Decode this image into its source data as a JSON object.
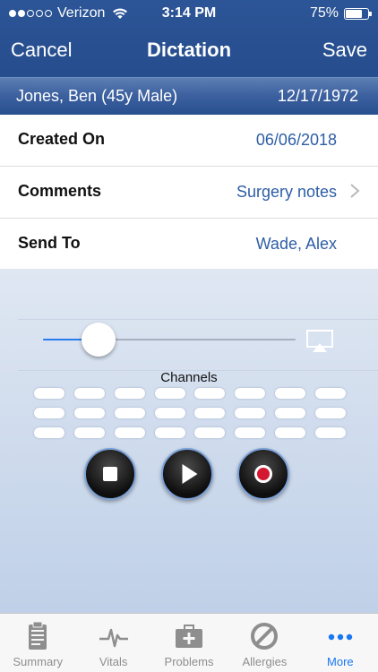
{
  "status_bar": {
    "carrier": "Verizon",
    "time": "3:14 PM",
    "battery": "75%",
    "battery_level": 0.75,
    "signal_bars": 2,
    "signal_total": 5
  },
  "nav": {
    "cancel_label": "Cancel",
    "title": "Dictation",
    "save_label": "Save"
  },
  "patient": {
    "name": "Jones, Ben (45y Male)",
    "dob": "12/17/1972"
  },
  "rows": [
    {
      "label": "Created On",
      "value": "06/06/2018"
    },
    {
      "label": "Comments",
      "value": "Surgery notes"
    },
    {
      "label": "Send To",
      "value": "Wade, Alex"
    }
  ],
  "recorder": {
    "volume_level": 0.22,
    "channels_label": "Channels",
    "channel_rows": 3,
    "channels_per_row": 8
  },
  "colors": {
    "header": "#2c5597",
    "link": "#2e5ea5",
    "active_tab": "#1877f2",
    "record": "#d3182f"
  },
  "tabs": [
    {
      "label": "Summary",
      "icon": "clipboard-icon",
      "active": false
    },
    {
      "label": "Vitals",
      "icon": "heartbeat-icon",
      "active": false
    },
    {
      "label": "Problems",
      "icon": "medical-kit-icon",
      "active": false
    },
    {
      "label": "Allergies",
      "icon": "prohibited-icon",
      "active": false
    },
    {
      "label": "More",
      "icon": "more-dots-icon",
      "active": true
    }
  ]
}
